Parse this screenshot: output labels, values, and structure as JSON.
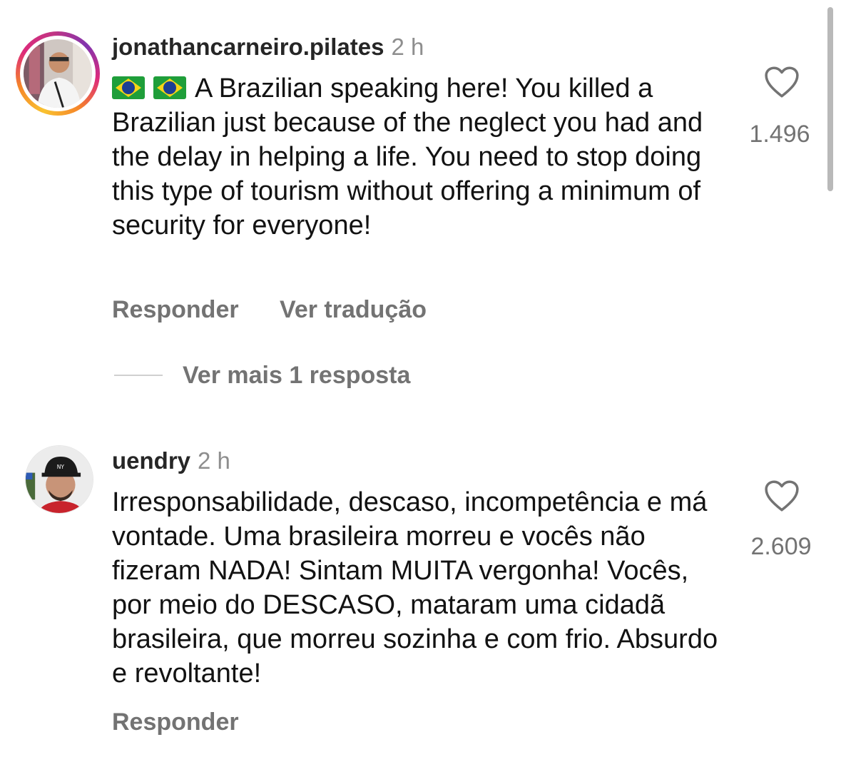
{
  "comments": [
    {
      "username": "jonathancarneiro.pilates",
      "time": "2 h",
      "has_story_ring": true,
      "flags": [
        "brazil-flag-emoji",
        "brazil-flag-emoji"
      ],
      "text": "A Brazilian speaking here! You killed a Brazilian just because of the neglect you had and the delay in helping a life. You need to stop doing this type of tourism without offering a minimum of security for everyone!",
      "like_count": "1.496",
      "reply_label": "Responder",
      "translate_label": "Ver tradução",
      "view_replies_label": "Ver mais 1 resposta"
    },
    {
      "username": "uendry",
      "time": "2 h",
      "has_story_ring": false,
      "text": "Irresponsabilidade, descaso, incompetência e má vontade. Uma brasileira morreu e vocês não fizeram NADA! Sintam MUITA vergonha! Vocês, por meio do DESCASO, mataram uma cidadã brasileira, que morreu sozinha e com frio. Absurdo e revoltante!",
      "like_count": "2.609",
      "reply_label": "Responder"
    }
  ],
  "icons": {
    "like": "heart-outline-icon"
  },
  "colors": {
    "text_primary": "#121212",
    "text_secondary": "#737373",
    "story_ring_gradient": [
      "#f9c230",
      "#f58529",
      "#dd2a7b",
      "#8134af"
    ]
  }
}
